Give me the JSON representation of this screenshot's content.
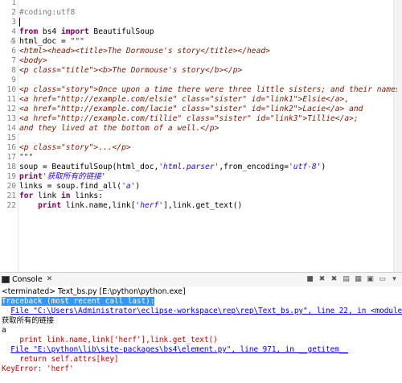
{
  "editor": {
    "line_numbers": [
      "1",
      "2",
      "3",
      "4",
      "5",
      "6",
      "7",
      "8",
      "9",
      "10",
      "11",
      "12",
      "13",
      "14",
      "15",
      "16",
      "17",
      "18",
      "19",
      "20",
      "21",
      "22"
    ],
    "fold_marks": {
      "5": "⊖"
    },
    "l2": "#coding:utf8",
    "l4": {
      "from": "from",
      "mod": " bs4 ",
      "import": "import",
      "name": " BeautifulSoup"
    },
    "l5": {
      "a": "html_doc = ",
      "s": "\"\"\""
    },
    "l6": "<html><head><title>The Dormouse's story</title></head>",
    "l7": "<body>",
    "l8": "<p class=\"title\"><b>The Dormouse's story</b></p>",
    "l10": "<p class=\"story\">Once upon a time there were three little sisters; and their names were",
    "l11": "<a href=\"http://example.com/elsie\" class=\"sister\" id=\"link1\">Elsie</a>,",
    "l12": "<a href=\"http://example.com/lacie\" class=\"sister\" id=\"link2\">Lacie</a> and",
    "l13": "<a href=\"http://example.com/tillie\" class=\"sister\" id=\"link3\">Tillie</a>;",
    "l14": "and they lived at the bottom of a well.</p>",
    "l16": "<p class=\"story\">...</p>",
    "l17": "\"\"\"",
    "l18": {
      "a": "soup = BeautifulSoup(html_doc,",
      "s1": "'html.parser'",
      "b": ",from_encoding=",
      "s2": "'utf-8'",
      "c": ")"
    },
    "l19": {
      "kw": "print",
      "s": "'获取所有的链接'"
    },
    "l20": {
      "a": "links = soup.find_all(",
      "s": "'a'",
      "b": ")"
    },
    "l21": {
      "for": "for",
      "a": " link ",
      "in": "in",
      "b": " links:"
    },
    "l22": {
      "ind": "    ",
      "kw": "print",
      "a": " link.name,link[",
      "s": "'herf'",
      "b": "],link.get_text()"
    }
  },
  "console": {
    "tab_label": "Console",
    "tab_close": "✕",
    "terminated": "<terminated> Text_bs.py [E:\\python\\python.exe]",
    "traceback": "Traceback (most recent call last):",
    "file1_prefix": "  ",
    "file1": "File \"C:\\Users\\Administrator\\eclipse-workspace\\rep\\rep\\Text_bs.py\", line 22, in <module>",
    "out1": "获取所有的链接",
    "out2": "a",
    "code1": "    print link.name,link['herf'],link.get_text()",
    "file2_prefix": "  ",
    "file2": "File \"E:\\python\\lib\\site-packages\\bs4\\element.py\", line 971, in __getitem__",
    "code2": "    return self.attrs[key]",
    "error": "KeyError: 'herf'"
  }
}
